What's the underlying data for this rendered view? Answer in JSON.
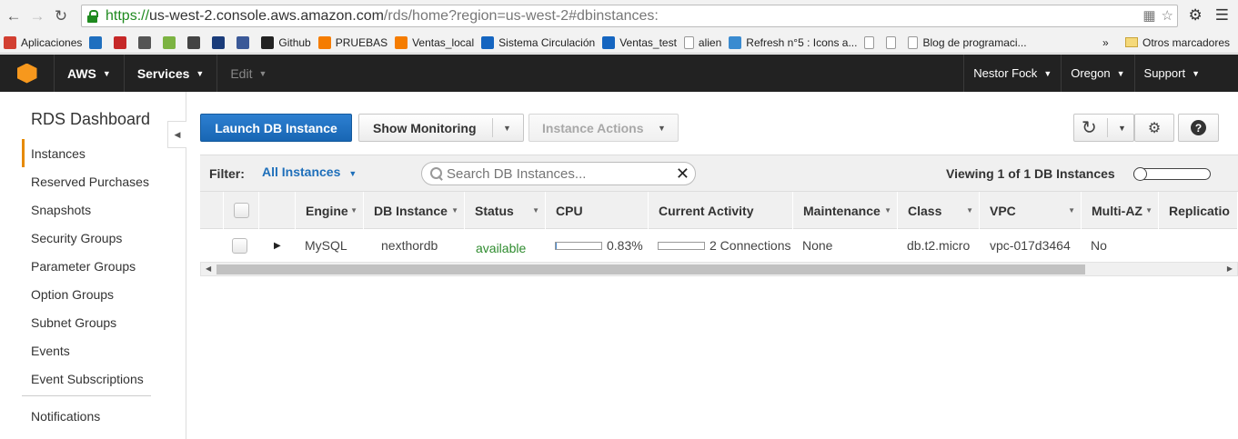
{
  "browser": {
    "url_protocol": "https://",
    "url_host": "us-west-2.console.aws.amazon.com",
    "url_path": "/rds/home?region=us-west-2#dbinstances:",
    "bookmarks": [
      {
        "label": "Aplicaciones",
        "icon": "apps-grid-icon",
        "color": "#d23f31"
      },
      {
        "label": "",
        "icon": "bookmark-blue-icon",
        "color": "#1f6fbf"
      },
      {
        "label": "",
        "icon": "bookmark-red-icon",
        "color": "#c62828"
      },
      {
        "label": "",
        "icon": "bookmark-asterisk-icon",
        "color": "#555555"
      },
      {
        "label": "",
        "icon": "bookmark-green-icon",
        "color": "#7cb342"
      },
      {
        "label": "",
        "icon": "bookmark-1x-icon",
        "color": "#444444"
      },
      {
        "label": "",
        "icon": "bookmark-globe-icon",
        "color": "#1a3c7a"
      },
      {
        "label": "",
        "icon": "facebook-icon",
        "color": "#3b5998"
      },
      {
        "label": "Github",
        "icon": "github-icon",
        "color": "#222222"
      },
      {
        "label": "PRUEBAS",
        "icon": "xampp-icon",
        "color": "#f57c00"
      },
      {
        "label": "Ventas_local",
        "icon": "xampp-icon",
        "color": "#f57c00"
      },
      {
        "label": "Sistema Circulación",
        "icon": "bookmark-d-icon",
        "color": "#1565c0"
      },
      {
        "label": "Ventas_test",
        "icon": "bookmark-d-icon",
        "color": "#1565c0"
      },
      {
        "label": "alien",
        "icon": "page-icon",
        "color": "#ffffff"
      },
      {
        "label": "Refresh n°5 : Icons a...",
        "icon": "globe-icon",
        "color": "#3a8bd0"
      },
      {
        "label": "",
        "icon": "page-icon",
        "color": "#ffffff"
      },
      {
        "label": "",
        "icon": "page-icon",
        "color": "#ffffff"
      },
      {
        "label": "Blog de programaci...",
        "icon": "page-icon",
        "color": "#ffffff"
      }
    ],
    "more_bookmarks": "»",
    "other_bookmarks": "Otros marcadores"
  },
  "aws_nav": {
    "brand": "AWS",
    "services": "Services",
    "edit": "Edit",
    "user": "Nestor Fock",
    "region": "Oregon",
    "support": "Support"
  },
  "sidebar": {
    "title": "RDS Dashboard",
    "items": [
      {
        "label": "Instances",
        "active": true
      },
      {
        "label": "Reserved Purchases"
      },
      {
        "label": "Snapshots"
      },
      {
        "label": "Security Groups"
      },
      {
        "label": "Parameter Groups"
      },
      {
        "label": "Option Groups"
      },
      {
        "label": "Subnet Groups"
      },
      {
        "label": "Events"
      },
      {
        "label": "Event Subscriptions"
      }
    ],
    "footer_item": "Notifications"
  },
  "toolbar": {
    "launch": "Launch DB Instance",
    "show_monitoring": "Show Monitoring",
    "instance_actions": "Instance Actions"
  },
  "filter": {
    "label": "Filter:",
    "value": "All Instances",
    "search_placeholder": "Search DB Instances...",
    "viewing": "Viewing 1 of 1 DB Instances"
  },
  "table": {
    "columns": [
      "Engine",
      "DB Instance",
      "Status",
      "CPU",
      "Current Activity",
      "Maintenance",
      "Class",
      "VPC",
      "Multi-AZ",
      "Replicatio"
    ],
    "rows": [
      {
        "engine": "MySQL",
        "db_instance": "nexthordb",
        "status": "available",
        "cpu": "0.83%",
        "cpu_fraction": 0.0083,
        "activity": "2 Connections",
        "activity_fraction": 0.0,
        "maintenance": "None",
        "class": "db.t2.micro",
        "vpc": "vpc-017d3464",
        "multi_az": "No"
      }
    ]
  },
  "colors": {
    "aws_bar": "#222222",
    "primary_button": "#1f6fbf",
    "active_marker": "#e68a00",
    "status_available": "#2e8b2e",
    "filter_link": "#1e6fba"
  }
}
